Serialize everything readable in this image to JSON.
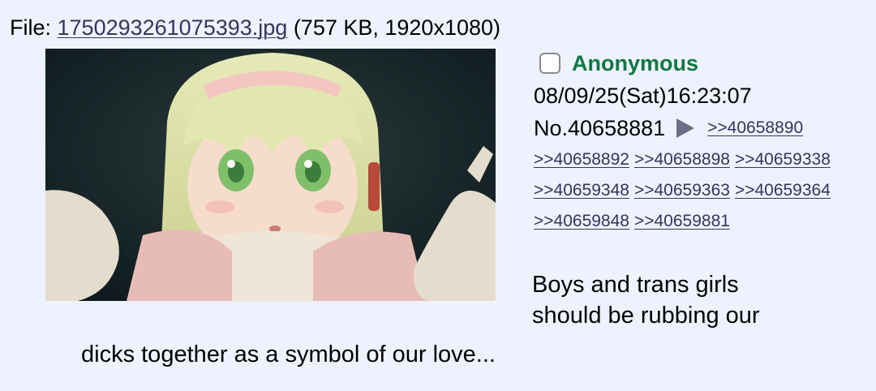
{
  "file": {
    "prefix": "File: ",
    "filename": "1750293261075393.jpg",
    "meta": " (757 KB, 1920x1080)"
  },
  "post": {
    "name": "Anonymous",
    "datetime": "08/09/25(Sat)16:23:07",
    "number": "No.40658881",
    "replies": [
      ">>40658890",
      ">>40658892",
      ">>40658898",
      ">>40659338",
      ">>40659348",
      ">>40659363",
      ">>40659364",
      ">>40659848",
      ">>40659881"
    ],
    "message_line1": "Boys and trans girls",
    "message_line2": "should be rubbing our",
    "message_line3": "dicks together as a symbol of our love..."
  },
  "colors": {
    "background": "#eef2ff",
    "name": "#117743",
    "link": "#34345c",
    "arrow": "#6b6f86"
  },
  "icons": {
    "checkbox": "checkbox-icon",
    "backlink_arrow": "triangle-right-icon"
  }
}
